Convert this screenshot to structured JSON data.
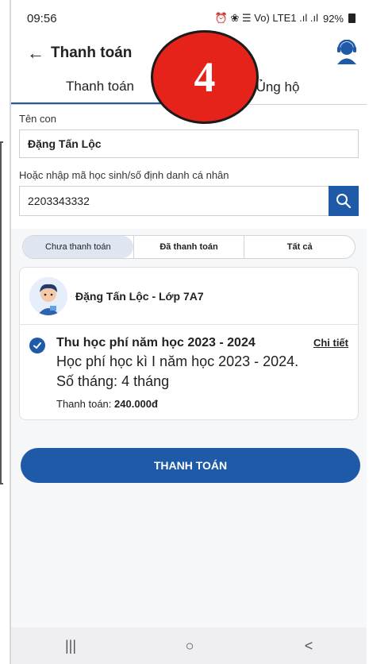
{
  "status_bar": {
    "time": "09:56",
    "indicators": "⏰ ❀ ☰ Vo) LTE1 .ıl .ıl",
    "battery": "92%"
  },
  "header": {
    "title": "Thanh toán"
  },
  "tabs": [
    {
      "label": "Thanh toán",
      "active": true
    },
    {
      "label": "Ủng hộ",
      "active": false
    }
  ],
  "step_badge": {
    "number": "4",
    "color": "#e5231b"
  },
  "form": {
    "child_label": "Tên con",
    "child_value": "Đặng Tấn Lộc",
    "id_label": "Hoặc nhập mã học sinh/số định danh cá nhân",
    "id_value": "2203343332"
  },
  "filter": {
    "options": [
      "Chưa thanh toán",
      "Đã thanh toán",
      "Tất cả"
    ],
    "selected": "Chưa thanh toán"
  },
  "card": {
    "student": "Đặng Tấn Lộc - Lớp 7A7",
    "fee": {
      "title": "Thu học phí năm học 2023 - 2024",
      "detail_link": "Chi tiết",
      "description": "Học phí học kì I năm học 2023 - 2024.",
      "months": "Số tháng: 4 tháng",
      "amount_label": "Thanh toán:",
      "amount_value": "240.000đ",
      "checked": true
    }
  },
  "pay_button": "THANH TOÁN",
  "nav": {
    "recents": "|||",
    "home": "○",
    "back": "<"
  },
  "colors": {
    "primary": "#1e5aa8",
    "badge": "#e5231b",
    "segment_selected": "#dfe6f2"
  }
}
